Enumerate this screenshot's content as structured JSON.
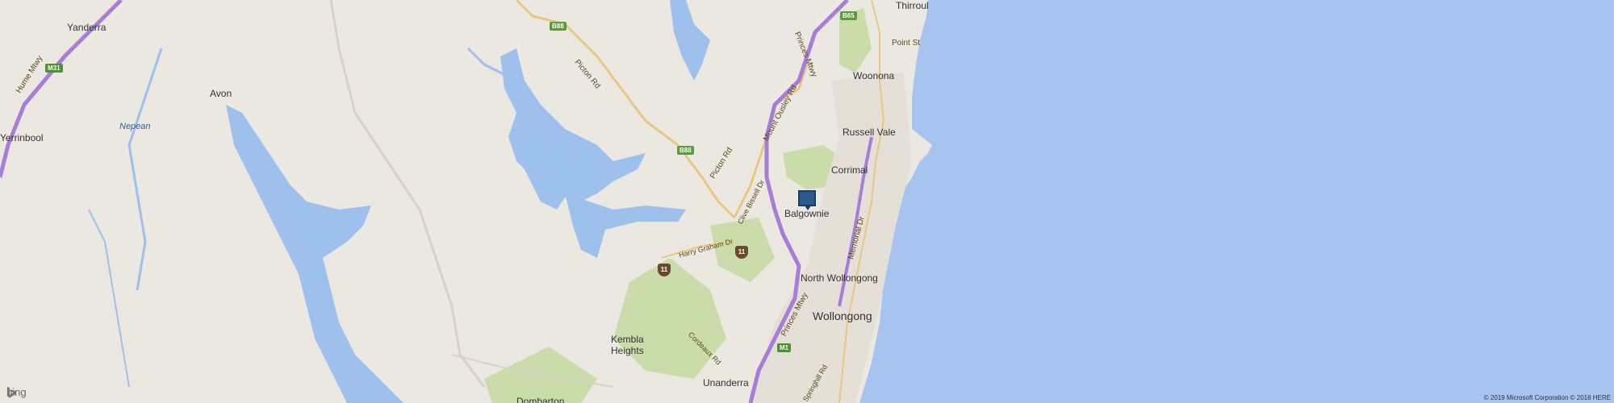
{
  "map": {
    "places": {
      "thirroul": "Thirroul",
      "yanderra": "Yanderra",
      "point_st": "Point St",
      "woonona": "Woonona",
      "avon": "Avon",
      "nepean": "Nepean",
      "yerrinbool": "Yerrinbool",
      "russell_vale": "Russell Vale",
      "corrimal": "Corrimal",
      "balgownie": "Balgownie",
      "north_wollongong": "North Wollongong",
      "wollongong": "Wollongong",
      "kembla_heights": "Kembla Heights",
      "unanderra": "Unanderra",
      "dombarton": "Dombarton"
    },
    "roads": {
      "hume_mtwy": "Hume Mtwy",
      "picton_rd_1": "Picton Rd",
      "picton_rd_2": "Picton Rd",
      "princes_mtwy_1": "Princes Mtwy",
      "princes_mtwy_2": "Princes Mtwy",
      "mount_ousley_rd": "Mount Ousley Rd",
      "clive_bissell_dr": "Clive Bissell Dr",
      "harry_graham_dr": "Harry Graham Dr",
      "memorial_dr": "Memorial Dr",
      "cordeaux_rd": "Cordeaux Rd",
      "springhill_rd": "Springhill Rd"
    },
    "shields": {
      "b65": "B65",
      "b88_1": "B88",
      "b88_2": "B88",
      "m31": "M31",
      "m1": "M1",
      "r11_1": "11",
      "r11_2": "11"
    },
    "colors": {
      "land": "#ebe8e1",
      "ocean": "#a7c3ef",
      "water": "#9ec0ec",
      "park": "#c9dcaa",
      "motorway": "#a77ed6",
      "road": "#e8c880",
      "pin": "#2a5b8c"
    }
  },
  "branding": {
    "logo_text": "bing",
    "copyright": "© 2019 Microsoft Corporation © 2018 HERE"
  }
}
